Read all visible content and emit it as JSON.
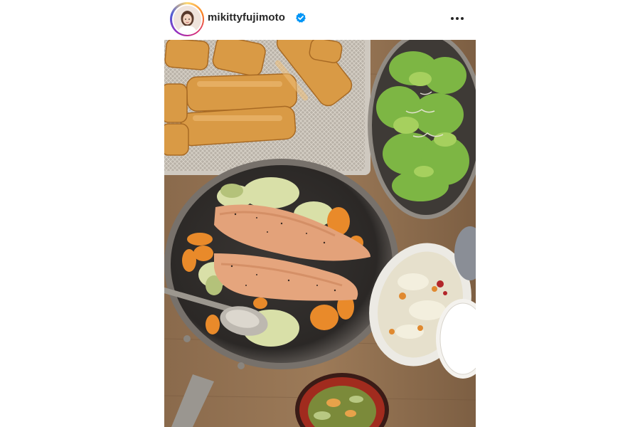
{
  "post": {
    "username": "mikittyfujimoto",
    "verified": true,
    "more_options_icon": "more-horizontal-icon",
    "verified_icon": "verified-badge-icon",
    "accent_colors": {
      "verified_blue": "#0095f6",
      "text": "#262626"
    }
  }
}
